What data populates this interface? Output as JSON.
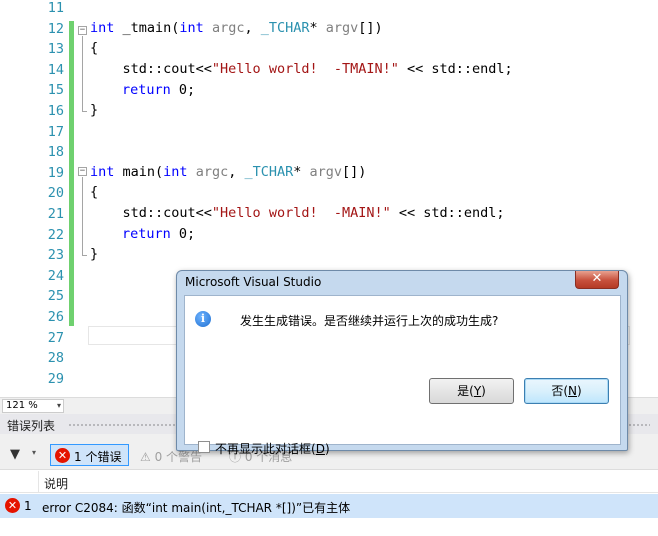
{
  "editor": {
    "line_numbers": [
      "11",
      "12",
      "13",
      "14",
      "15",
      "16",
      "17",
      "18",
      "19",
      "20",
      "21",
      "22",
      "23",
      "24",
      "25",
      "26",
      "27",
      "28",
      "29"
    ],
    "code": {
      "l12_kw": "int",
      "l12_name": " _tmain(",
      "l12_kw2": "int",
      "l12_p1": " argc",
      "l12_sep": ", ",
      "l12_ty": "_TCHAR",
      "l12_rest": "* ",
      "l12_p2": "argv",
      "l12_end": "[])",
      "l13": "{",
      "l14_pre": "    std::cout<<",
      "l14_str": "\"Hello world!  -TMAIN!\"",
      "l14_post": " << std::endl;",
      "l15_kw": "return",
      "l15_rest": " 0;",
      "l16": "}",
      "l19_kw": "int",
      "l19_name": " main(",
      "l19_kw2": "int",
      "l19_p1": " argc",
      "l19_sep": ", ",
      "l19_ty": "_TCHAR",
      "l19_rest": "* ",
      "l19_p2": "argv",
      "l19_end": "[])",
      "l20": "{",
      "l21_pre": "    std::cout<<",
      "l21_str": "\"Hello world!  -MAIN!\"",
      "l21_post": " << std::endl;",
      "l22_kw": "return",
      "l22_rest": " 0;",
      "l23": "}"
    },
    "fold_minus": "−"
  },
  "zoom": {
    "value": "121 %",
    "arrow": "▾"
  },
  "error_list": {
    "title": "错误列表",
    "filter_icon": "▼",
    "filter_dropdown": "▾",
    "errors_button": "1 个错误",
    "error_symbol": "✕",
    "warnings_button": "⚠ 0 个警告",
    "messages_button": "ⓘ 0 个消息",
    "column_description": "说明",
    "rows": [
      {
        "num": "1",
        "description": "error C2084: 函数“int main(int,_TCHAR *[])”已有主体"
      }
    ]
  },
  "dialog": {
    "title": "Microsoft Visual Studio",
    "close_glyph": "✕",
    "info_glyph": "i",
    "message": "发生生成错误。是否继续并运行上次的成功生成?",
    "yes_prefix": "是(",
    "yes_key": "Y",
    "yes_suffix": ")",
    "no_prefix": "否(",
    "no_key": "N",
    "no_suffix": ")",
    "checkbox_prefix": "不再显示此对话框(",
    "checkbox_key": "D",
    "checkbox_suffix": ")"
  }
}
